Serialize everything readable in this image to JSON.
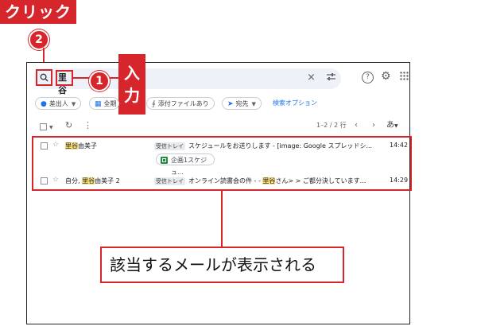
{
  "callouts": {
    "click_label": "クリック",
    "step2_number": "2",
    "step1_number": "1",
    "input_label_chars": [
      "入",
      "力"
    ],
    "result_caption": "該当するメールが表示される"
  },
  "search": {
    "query": "里谷"
  },
  "header_icons": {
    "clear": "×",
    "filter": "☷",
    "help": "?",
    "settings": "⚙",
    "apps": "⋮⋮"
  },
  "filter_chips": [
    {
      "label": "差出人",
      "icon": "person-icon"
    },
    {
      "label": "全期",
      "icon": "calendar-icon"
    },
    {
      "label": "添付ファイルあり",
      "icon": "paperclip-icon"
    },
    {
      "label": "宛先",
      "icon": "send-icon"
    }
  ],
  "advanced_search": "検索オプション",
  "pagination": {
    "range": "1–2 / 2 行",
    "sort": "あ"
  },
  "emails": [
    {
      "sender_before": "",
      "sender_highlight": "里谷",
      "sender_after": "由美子",
      "label": "受信トレイ",
      "subject": "スケジュールをお送りします - [image: Google スプレッドシ...",
      "attachment": "企画1スケジュ...",
      "time": "14:42"
    },
    {
      "sender_before": "自分, ",
      "sender_highlight": "里谷",
      "sender_after": "由美子 2",
      "label": "受信トレイ",
      "subject_before": "オンライン読書会の件 - - ",
      "subject_highlight": "里谷",
      "subject_after": "さん> > ご都分決しています...",
      "time": "14:29"
    }
  ],
  "colors": {
    "accent": "#d7262b",
    "highlight": "#f7dd7e",
    "link": "#1a73e8"
  }
}
